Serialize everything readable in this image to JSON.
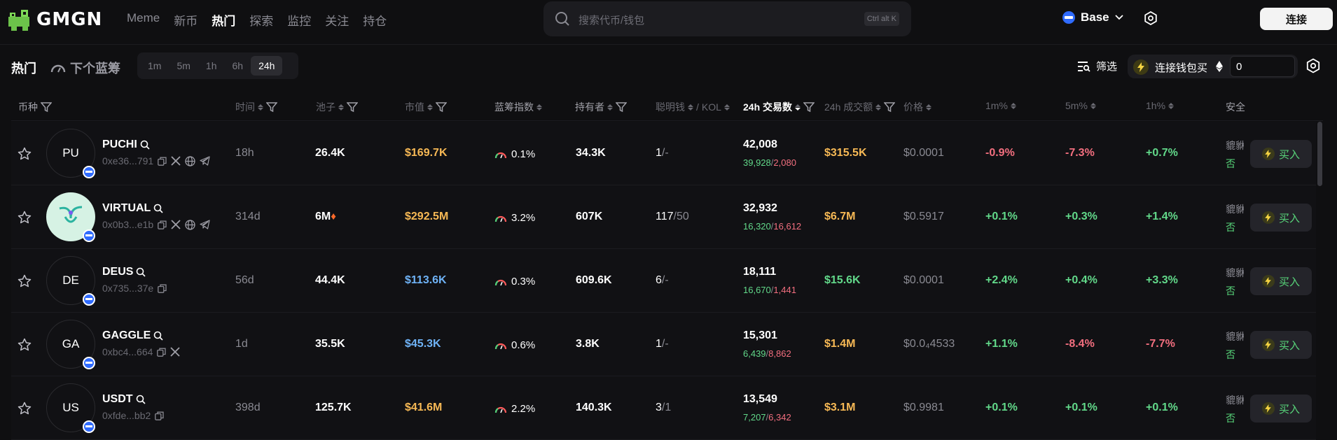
{
  "nav": {
    "brand": "GMGN",
    "links": [
      "Meme",
      "新币",
      "热门",
      "探索",
      "监控",
      "关注",
      "持仓"
    ],
    "active": "热门",
    "search_placeholder": "搜索代币/钱包",
    "search_shortcut": "Ctrl alt K",
    "chain": "Base",
    "connect_label": "连接"
  },
  "subbar": {
    "title": "热门",
    "bluechip_label": "下个蓝筹",
    "timeframes": [
      "1m",
      "5m",
      "1h",
      "6h",
      "24h"
    ],
    "active_timeframe": "24h",
    "filter_label": "筛选",
    "quickbuy_label": "连接钱包买",
    "quickbuy_amount": "0"
  },
  "columns": {
    "token": "币种",
    "age": "时间",
    "pool": "池子",
    "mcap": "市值",
    "bluechip": "蓝筹指数",
    "holders": "持有者",
    "smart": "聪明钱",
    "kol": "KOL",
    "tx": "24h 交易数",
    "volume": "24h 成交额",
    "price": "价格",
    "m1": "1m%",
    "m5": "5m%",
    "h1": "1h%",
    "security": "安全"
  },
  "rows": [
    {
      "abbr": "PU",
      "name": "PUCHI",
      "addr": "0xe36...791",
      "socials": [
        "copy",
        "x",
        "web",
        "telegram"
      ],
      "age": "18h",
      "pool": "26.4K",
      "pool_fire": false,
      "mcap": "$169.7K",
      "mcap_color": "orange",
      "bluechip": "0.1%",
      "holders": "34.3K",
      "smart": "1",
      "kol": "-",
      "tx": "42,008",
      "buys": "39,928",
      "sells": "2,080",
      "volume": "$315.5K",
      "vol_color": "orange",
      "price": "$0.0001",
      "m1": "-0.9%",
      "m1c": "red",
      "m5": "-7.3%",
      "m5c": "red",
      "h1": "+0.7%",
      "h1c": "green",
      "sec1": "貔貅",
      "sec2": "否",
      "buy_label": "买入"
    },
    {
      "abbr": "",
      "name": "VIRTUAL",
      "addr": "0x0b3...e1b",
      "socials": [
        "copy",
        "x",
        "web",
        "telegram"
      ],
      "age": "314d",
      "pool": "6M",
      "pool_fire": true,
      "mcap": "$292.5M",
      "mcap_color": "orange",
      "bluechip": "3.2%",
      "holders": "607K",
      "smart": "117",
      "kol": "50",
      "tx": "32,932",
      "buys": "16,320",
      "sells": "16,612",
      "volume": "$6.7M",
      "vol_color": "orange",
      "price": "$0.5917",
      "m1": "+0.1%",
      "m1c": "green",
      "m5": "+0.3%",
      "m5c": "green",
      "h1": "+1.4%",
      "h1c": "green",
      "sec1": "貔貅",
      "sec2": "否",
      "buy_label": "买入"
    },
    {
      "abbr": "DE",
      "name": "DEUS",
      "addr": "0x735...37e",
      "socials": [
        "copy"
      ],
      "age": "56d",
      "pool": "44.4K",
      "pool_fire": false,
      "mcap": "$113.6K",
      "mcap_color": "blue",
      "bluechip": "0.3%",
      "holders": "609.6K",
      "smart": "6",
      "kol": "-",
      "tx": "18,111",
      "buys": "16,670",
      "sells": "1,441",
      "volume": "$15.6K",
      "vol_color": "green",
      "price": "$0.0001",
      "m1": "+2.4%",
      "m1c": "green",
      "m5": "+0.4%",
      "m5c": "green",
      "h1": "+3.3%",
      "h1c": "green",
      "sec1": "貔貅",
      "sec2": "否",
      "buy_label": "买入"
    },
    {
      "abbr": "GA",
      "name": "GAGGLE",
      "addr": "0xbc4...664",
      "socials": [
        "copy",
        "x"
      ],
      "age": "1d",
      "pool": "35.5K",
      "pool_fire": false,
      "mcap": "$45.3K",
      "mcap_color": "blue",
      "bluechip": "0.6%",
      "holders": "3.8K",
      "smart": "1",
      "kol": "-",
      "tx": "15,301",
      "buys": "6,439",
      "sells": "8,862",
      "volume": "$1.4M",
      "vol_color": "orange",
      "price": "$0.0₄4533",
      "m1": "+1.1%",
      "m1c": "green",
      "m5": "-8.4%",
      "m5c": "red",
      "h1": "-7.7%",
      "h1c": "red",
      "sec1": "貔貅",
      "sec2": "否",
      "buy_label": "买入"
    },
    {
      "abbr": "US",
      "name": "USDT",
      "addr": "0xfde...bb2",
      "socials": [
        "copy"
      ],
      "age": "398d",
      "pool": "125.7K",
      "pool_fire": false,
      "mcap": "$41.6M",
      "mcap_color": "orange",
      "bluechip": "2.2%",
      "holders": "140.3K",
      "smart": "3",
      "kol": "1",
      "tx": "13,549",
      "buys": "7,207",
      "sells": "6,342",
      "volume": "$3.1M",
      "vol_color": "orange",
      "price": "$0.9981",
      "m1": "+0.1%",
      "m1c": "green",
      "m5": "+0.1%",
      "m5c": "green",
      "h1": "+0.1%",
      "h1c": "green",
      "sec1": "貔貅",
      "sec2": "否",
      "buy_label": "买入"
    }
  ]
}
